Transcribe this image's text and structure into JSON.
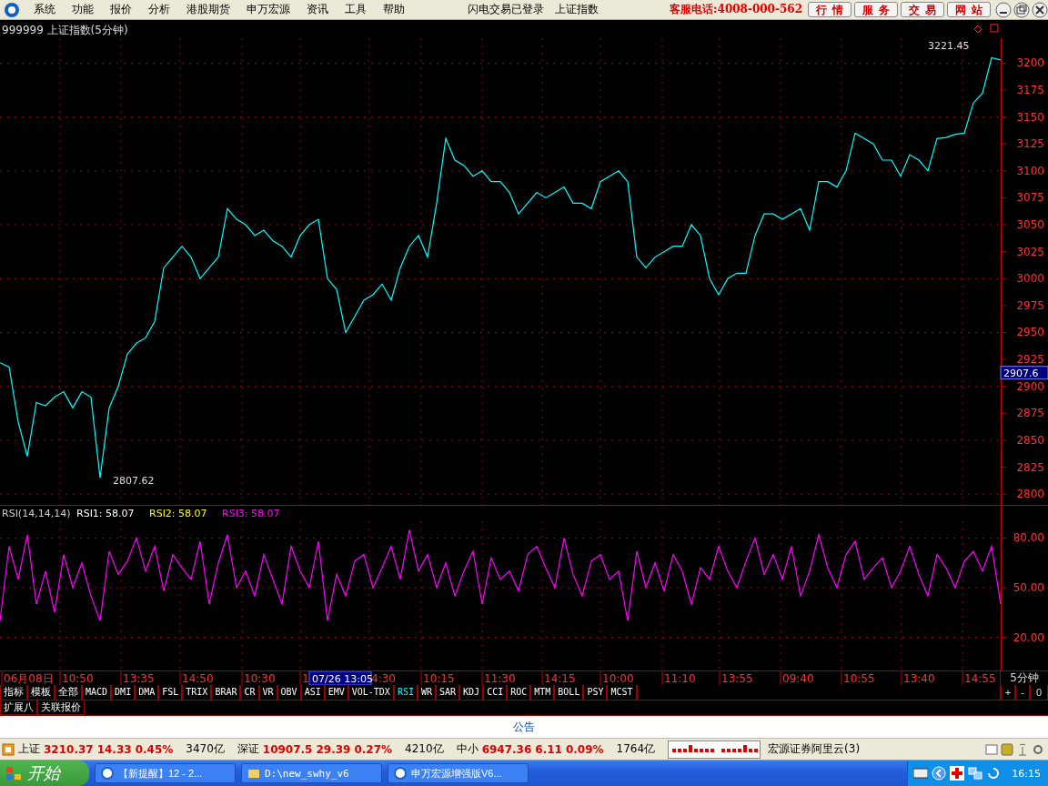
{
  "menu_bar": {
    "items": [
      "系统",
      "功能",
      "报价",
      "分析",
      "港股期货",
      "申万宏源",
      "资讯",
      "工具",
      "帮助"
    ],
    "login_status": "闪电交易已登录",
    "index_name": "上证指数",
    "hotline": "客服电话:4008-000-562",
    "shortcuts": [
      "行情",
      "服务",
      "交易",
      "网站"
    ]
  },
  "price_chart": {
    "title": "999999 上证指数(5分钟)",
    "high_label": "3221.45",
    "low_label": "2807.62",
    "price_tag": "2907.6",
    "chart_data": {
      "type": "line",
      "grid": true,
      "ylim": [
        2790,
        3240
      ],
      "yticks": [
        2800,
        2825,
        2850,
        2875,
        2900,
        2925,
        2950,
        2975,
        3000,
        3025,
        3050,
        3075,
        3100,
        3125,
        3150,
        3175,
        3200
      ],
      "series": [
        {
          "color": "#00ffff",
          "values": [
            2922,
            2918,
            2867,
            2835,
            2885,
            2882,
            2890,
            2895,
            2880,
            2895,
            2890,
            2815,
            2880,
            2900,
            2930,
            2940,
            2945,
            2960,
            3010,
            3020,
            3030,
            3020,
            3000,
            3010,
            3020,
            3065,
            3055,
            3050,
            3040,
            3045,
            3035,
            3030,
            3020,
            3040,
            3050,
            3055,
            3000,
            2990,
            2950,
            2965,
            2980,
            2985,
            2995,
            2980,
            3010,
            3030,
            3040,
            3020,
            3070,
            3130,
            3110,
            3105,
            3095,
            3100,
            3090,
            3090,
            3080,
            3060,
            3070,
            3080,
            3075,
            3080,
            3085,
            3070,
            3070,
            3065,
            3090,
            3095,
            3100,
            3090,
            3020,
            3010,
            3020,
            3025,
            3030,
            3030,
            3050,
            3040,
            3000,
            2985,
            3000,
            3005,
            3005,
            3040,
            3060,
            3060,
            3055,
            3060,
            3065,
            3045,
            3090,
            3090,
            3085,
            3100,
            3135,
            3130,
            3125,
            3110,
            3110,
            3095,
            3115,
            3110,
            3100,
            3130,
            3131,
            3134,
            3135,
            3163,
            3172,
            3205,
            3203
          ]
        }
      ]
    }
  },
  "rsi": {
    "params": "RSI(14,14,14)",
    "lines": [
      {
        "label": "RSI1: 58.07",
        "color": "#ffffff"
      },
      {
        "label": "RSI2: 58.07",
        "color": "#ffff00"
      },
      {
        "label": "RSI3: 58.07",
        "color": "#ff00ff"
      }
    ],
    "chart_data": {
      "type": "line",
      "grid": true,
      "ylim": [
        0,
        100
      ],
      "yticks": [
        {
          "value": 20,
          "label": "20.00"
        },
        {
          "value": 50,
          "label": "50.00"
        },
        {
          "value": 80,
          "label": "80.00"
        }
      ],
      "series": [
        {
          "color": "#ff00ff",
          "values": [
            30,
            75,
            55,
            82,
            40,
            60,
            35,
            70,
            50,
            65,
            45,
            30,
            72,
            58,
            66,
            80,
            60,
            75,
            48,
            70,
            62,
            55,
            78,
            40,
            65,
            82,
            50,
            60,
            45,
            70,
            55,
            40,
            75,
            60,
            50,
            78,
            30,
            58,
            45,
            66,
            70,
            50,
            62,
            75,
            55,
            85,
            60,
            70,
            50,
            65,
            45,
            60,
            72,
            40,
            68,
            55,
            60,
            48,
            70,
            75,
            62,
            50,
            80,
            58,
            45,
            66,
            70,
            55,
            60,
            30,
            72,
            50,
            65,
            48,
            70,
            60,
            40,
            62,
            55,
            75,
            60,
            50,
            66,
            80,
            58,
            70,
            55,
            75,
            45,
            60,
            82,
            62,
            50,
            70,
            78,
            55,
            62,
            68,
            50,
            60,
            75,
            58,
            45,
            70,
            62,
            50,
            66,
            72,
            60,
            75,
            40
          ]
        }
      ]
    }
  },
  "time_axis": {
    "labels": [
      "06月08日",
      "10:50",
      "13:35",
      "14:50",
      "10:30",
      "1",
      "4:30",
      "10:15",
      "11:30",
      "14:15",
      "10:00",
      "11:10",
      "13:55",
      "09:40",
      "10:55",
      "13:40",
      "14:55"
    ],
    "cursor_label": "07/26 13:05",
    "period": "5分钟"
  },
  "indicator_tabs": [
    {
      "label": "指标",
      "selected": false
    },
    {
      "label": "模板",
      "selected": false
    },
    {
      "label": "全部",
      "selected": false
    },
    {
      "label": "MACD",
      "selected": false
    },
    {
      "label": "DMI",
      "selected": false
    },
    {
      "label": "DMA",
      "selected": false
    },
    {
      "label": "FSL",
      "selected": false
    },
    {
      "label": "TRIX",
      "selected": false
    },
    {
      "label": "BRAR",
      "selected": false
    },
    {
      "label": "CR",
      "selected": false
    },
    {
      "label": "VR",
      "selected": false
    },
    {
      "label": "OBV",
      "selected": false
    },
    {
      "label": "ASI",
      "selected": false
    },
    {
      "label": "EMV",
      "selected": false
    },
    {
      "label": "VOL-TDX",
      "selected": false
    },
    {
      "label": "RSI",
      "selected": true
    },
    {
      "label": "WR",
      "selected": false
    },
    {
      "label": "SAR",
      "selected": false
    },
    {
      "label": "KDJ",
      "selected": false
    },
    {
      "label": "CCI",
      "selected": false
    },
    {
      "label": "ROC",
      "selected": false
    },
    {
      "label": "MTM",
      "selected": false
    },
    {
      "label": "BOLL",
      "selected": false
    },
    {
      "label": "PSY",
      "selected": false
    },
    {
      "label": "MCST",
      "selected": false
    }
  ],
  "zoom_buttons": [
    "+",
    "-",
    "0"
  ],
  "extra_tabs": [
    "扩展八",
    "关联报价"
  ],
  "notice": "公告",
  "status_bar": {
    "markets": [
      {
        "name": "上证",
        "price": "3210.37",
        "change": "14.33",
        "percent": "0.45%",
        "volume": "3470亿"
      },
      {
        "name": "深证",
        "price": "10907.5",
        "change": "29.39",
        "percent": "0.27%",
        "volume": "4210亿"
      },
      {
        "name": "中小",
        "price": "6947.36",
        "change": "6.11",
        "percent": "0.09%",
        "volume": "1764亿"
      }
    ],
    "broker": "宏源证券阿里云(3)"
  },
  "taskbar": {
    "start": "开始",
    "tasks": [
      "【新提醒】12 - 2...",
      "D:\\new_swhy_v6",
      "申万宏源增强版V6..."
    ],
    "clock": "16:15"
  }
}
